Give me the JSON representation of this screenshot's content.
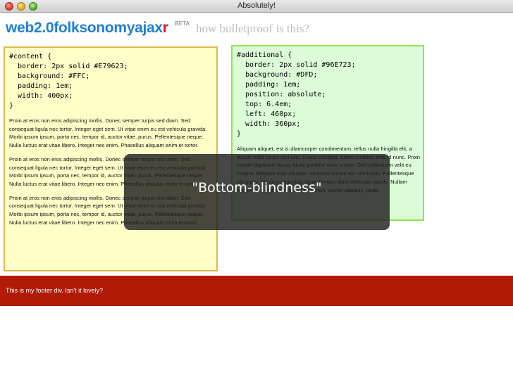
{
  "window": {
    "title": "Absolutely!"
  },
  "header": {
    "logo_main": "web2.0folksonomyajax",
    "logo_end": "r",
    "beta": "BETA",
    "tagline": "how bulletproof is this?"
  },
  "content_box": {
    "css": "#content {\n  border: 2px solid #E79623;\n  background: #FFC;\n  padding: 1em;\n  width: 400px;\n}",
    "paragraphs": [
      "Proin at eros non eros adipiscing mollis. Donec semper turpis sed diam. Sed consequat ligula nec tortor. Integer eget sem. Ut vitae enim eu est vehicula gravida. Morbi ipsum ipsum, porta nec, tempor id, auctor vitae, purus. Pellentesque neque. Nulla luctus erat vitae libero. Integer nec enim. Phasellus aliquam enim et tortor.",
      "Proin at eros non eros adipiscing mollis. Donec semper turpis sed diam. Sed consequat ligula nec tortor. Integer eget sem. Ut vitae enim eu est vehicula gravida. Morbi ipsum ipsum, porta nec, tempor id, auctor vitae, purus. Pellentesque neque. Nulla luctus erat vitae libero. Integer nec enim. Phasellus aliquam enim et tortor.",
      "Proin at eros non eros adipiscing mollis. Donec semper turpis sed diam. Sed consequat ligula nec tortor. Integer eget sem. Ut vitae enim eu est vehicula gravida. Morbi ipsum ipsum, porta nec, tempor id, auctor vitae, purus. Pellentesque neque. Nulla luctus erat vitae libero. Integer nec enim. Phasellus aliquam enim et tortor."
    ]
  },
  "additional_box": {
    "css": "#additional {\n  border: 2px solid #96E723;\n  background: #DFD;\n  padding: 1em;\n  position: absolute;\n  top: 6.4em;\n  left: 460px;\n  width: 360px;\n}",
    "paragraph": "Aliquam aliquet, est a ullamcorper condimentum, tellus nulla fringilla elit, a iaculis nulla turpis sed wisi. Fusce volutpat. Etiam sodales ante id nunc. Proin ornare dignissim lacus. Nunc porttitor nunc a sem. Sed sollicitudin velit eu magna. Aliquam erat volutpat. Vivamus ornare est non turpis. Pellentesque vel quam. Vivamus egestas. Nunc tempor diam vehicula mauris. Nullam sapien eros, facilisis vel, eleifend non, auctor dapibus, pede."
  },
  "footer": {
    "text": "This is my footer div. Isn't it lovely?"
  },
  "overlay": {
    "caption": "\"Bottom-blindness\""
  },
  "colors": {
    "logo_blue": "#1f7fd6",
    "logo_red": "#e0142a",
    "content_bg": "#ffffc8",
    "content_border": "#e0b84b",
    "additional_bg": "#dcfcd8",
    "additional_border": "#94e24a",
    "footer_bg": "#b01a07"
  }
}
